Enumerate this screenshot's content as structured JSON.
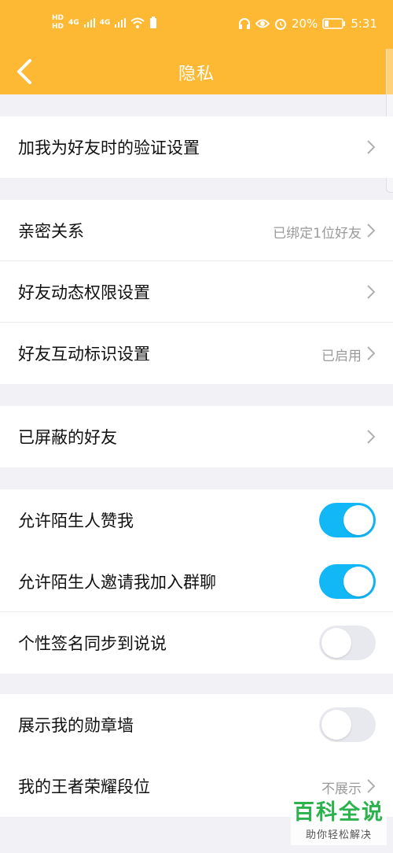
{
  "status_bar": {
    "hd_top": "HD",
    "hd_bottom": "HD",
    "sim1": "4G",
    "sim2": "4G",
    "battery_percent": "20%",
    "time": "5:31"
  },
  "nav": {
    "title": "隐私"
  },
  "sections": [
    {
      "rows": [
        {
          "label": "加我为好友时的验证设置",
          "value": ""
        }
      ]
    },
    {
      "rows": [
        {
          "label": "亲密关系",
          "value": "已绑定1位好友"
        },
        {
          "label": "好友动态权限设置",
          "value": ""
        },
        {
          "label": "好友互动标识设置",
          "value": "已启用"
        }
      ]
    },
    {
      "rows": [
        {
          "label": "已屏蔽的好友",
          "value": ""
        }
      ]
    },
    {
      "rows": [
        {
          "label": "允许陌生人赞我",
          "toggle": true
        },
        {
          "label": "允许陌生人邀请我加入群聊",
          "toggle": true
        },
        {
          "label": "个性签名同步到说说",
          "toggle": false
        }
      ]
    },
    {
      "rows": [
        {
          "label": "展示我的勋章墙",
          "toggle": false
        },
        {
          "label": "我的王者荣耀段位",
          "value": "不展示"
        }
      ]
    }
  ],
  "watermark": {
    "title": "百科全说",
    "subtitle": "助你轻松解决"
  },
  "colors": {
    "header": "#fdb933",
    "toggle_on": "#12b7f5",
    "toggle_off": "#e8e9ee",
    "watermark": "#2bb24c"
  }
}
